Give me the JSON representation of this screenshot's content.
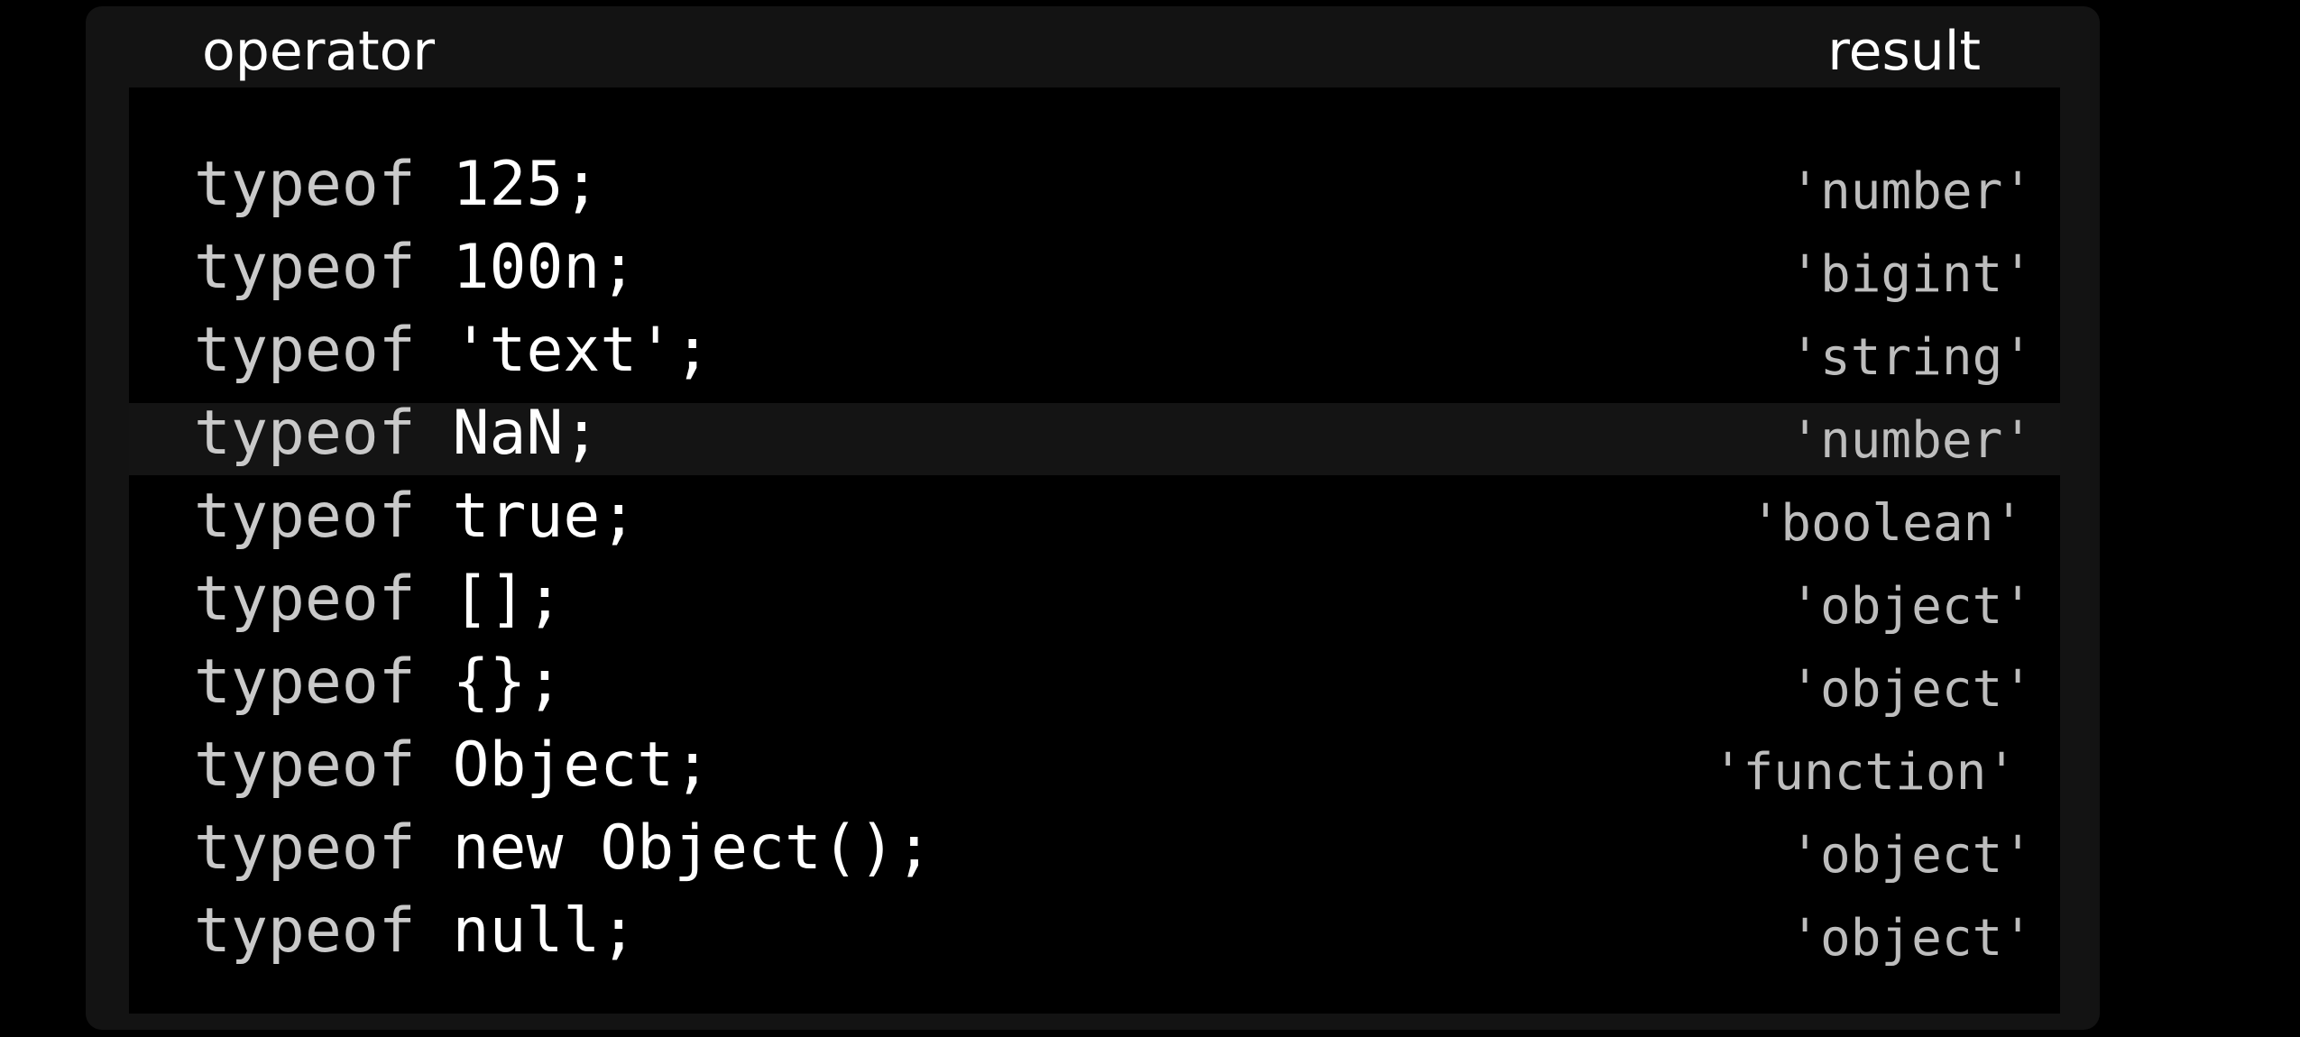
{
  "header": {
    "operator_label": "operator",
    "result_label": "result"
  },
  "rows": [
    {
      "keyword": "typeof",
      "argument": "125;",
      "result": "'number'"
    },
    {
      "keyword": "typeof",
      "argument": "100n;",
      "result": "'bigint'"
    },
    {
      "keyword": "typeof",
      "argument": "'text';",
      "result": "'string'"
    },
    {
      "keyword": "typeof",
      "argument": "NaN;",
      "result": "'number'",
      "highlighted": true
    },
    {
      "keyword": "typeof",
      "argument": "true;",
      "result": "'boolean'"
    },
    {
      "keyword": "typeof",
      "argument": "[];",
      "result": "'object'"
    },
    {
      "keyword": "typeof",
      "argument": "{};",
      "result": "'object'"
    },
    {
      "keyword": "typeof",
      "argument": "Object;",
      "result": "'function'"
    },
    {
      "keyword": "typeof",
      "argument": "new Object();",
      "result": "'object'"
    },
    {
      "keyword": "typeof",
      "argument": "null;",
      "result": "'object'"
    }
  ],
  "colors": {
    "background": "#000000",
    "panel": "#131313",
    "highlight_row": "#141414",
    "keyword_text": "#c9c9c9",
    "argument_text": "#ffffff",
    "result_text": "#bdbdbd",
    "header_text": "#ffffff"
  }
}
